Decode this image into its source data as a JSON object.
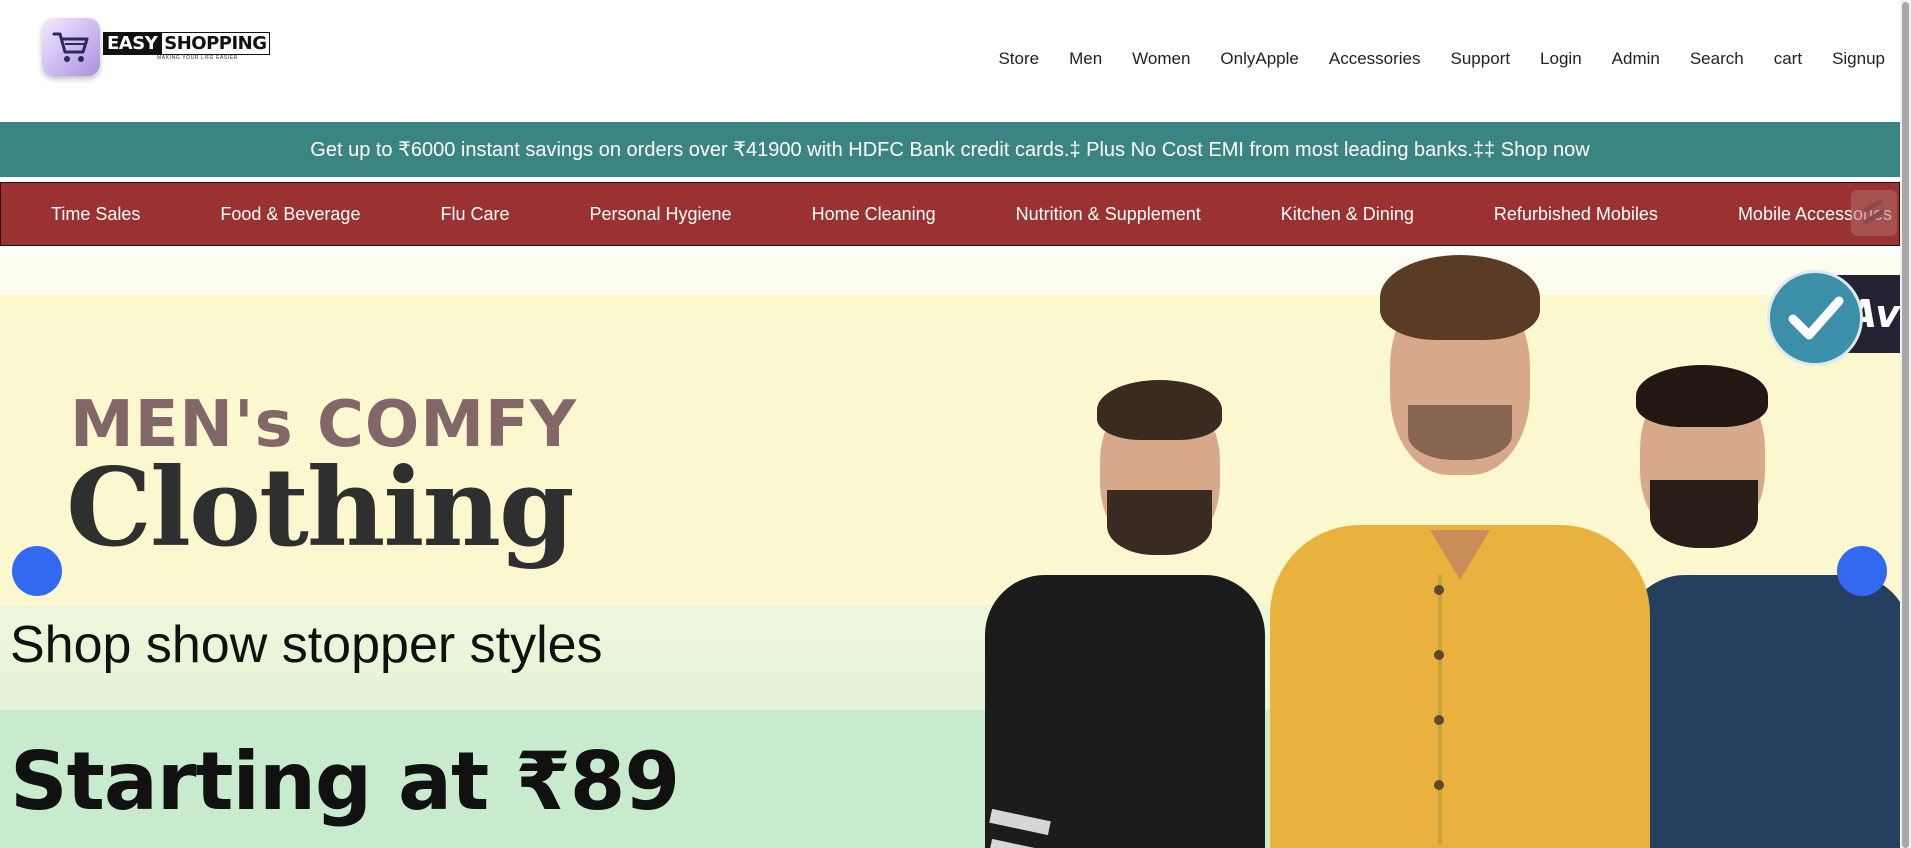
{
  "header": {
    "logo": {
      "word1": "EASY",
      "word2": "SHOPPING",
      "tagline": "MAKING YOUR LIFE EASIER",
      "icon": "shopping-cart-icon"
    },
    "nav": [
      "Store",
      "Men",
      "Women",
      "OnlyApple",
      "Accessories",
      "Support",
      "Login",
      "Admin",
      "Search",
      "cart",
      "Signup"
    ]
  },
  "promo": {
    "text": "Get up to ₹6000 instant savings on orders over ₹41900 with HDFC Bank credit cards.‡ Plus No Cost EMI from most leading banks.‡‡ Shop now"
  },
  "categories": [
    "Time Sales",
    "Food & Beverage",
    "Flu Care",
    "Personal Hygiene",
    "Home Cleaning",
    "Nutrition & Supplement",
    "Kitchen & Dining",
    "Refurbished Mobiles",
    "Mobile Accessories"
  ],
  "hero": {
    "line1": "MEN's COMFY",
    "line2": "Clothing",
    "line3": "Shop show stopper styles",
    "line4": "Starting at ₹89",
    "badge_text": "Av",
    "prev_icon": "circle-left-arrow",
    "next_icon": "circle-right-arrow"
  },
  "colors": {
    "promo_bg": "#3a8482",
    "category_bg": "#993230",
    "arrow_btn": "#3368f0"
  }
}
